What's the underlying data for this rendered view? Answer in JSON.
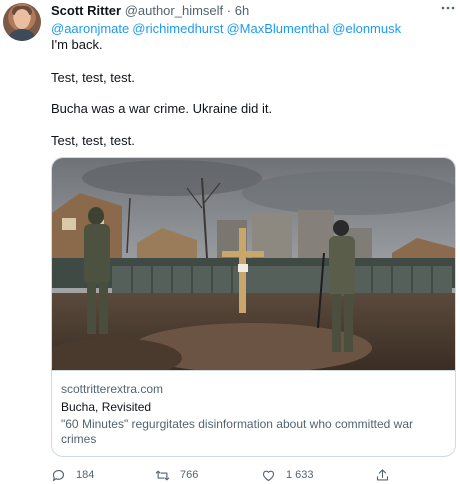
{
  "tweet": {
    "author_name": "Scott Ritter",
    "author_handle": "@author_himself",
    "separator": " · ",
    "timestamp": "6h",
    "mentions": [
      "@aaronjmate",
      "@richimedhurst",
      "@MaxBlumenthal",
      "@elonmusk"
    ],
    "lines": [
      "I'm back.",
      "Test, test, test.",
      "Bucha was a war crime. Ukraine did it.",
      "Test, test, test."
    ]
  },
  "card": {
    "domain": "scottritterextra.com",
    "title": "Bucha, Revisited",
    "description": "\"60 Minutes\" regurgitates disinformation about who committed war crimes"
  },
  "actions": {
    "reply_count": "184",
    "retweet_count": "766",
    "like_count": "1 633"
  },
  "icons": {
    "avatar": "avatar",
    "more": "more-icon",
    "reply": "reply-icon",
    "retweet": "retweet-icon",
    "like": "heart-icon",
    "share": "share-icon"
  },
  "colors": {
    "link": "#1d9bf0",
    "text": "#0f1419",
    "secondary": "#536471",
    "border": "#cfd9de"
  }
}
